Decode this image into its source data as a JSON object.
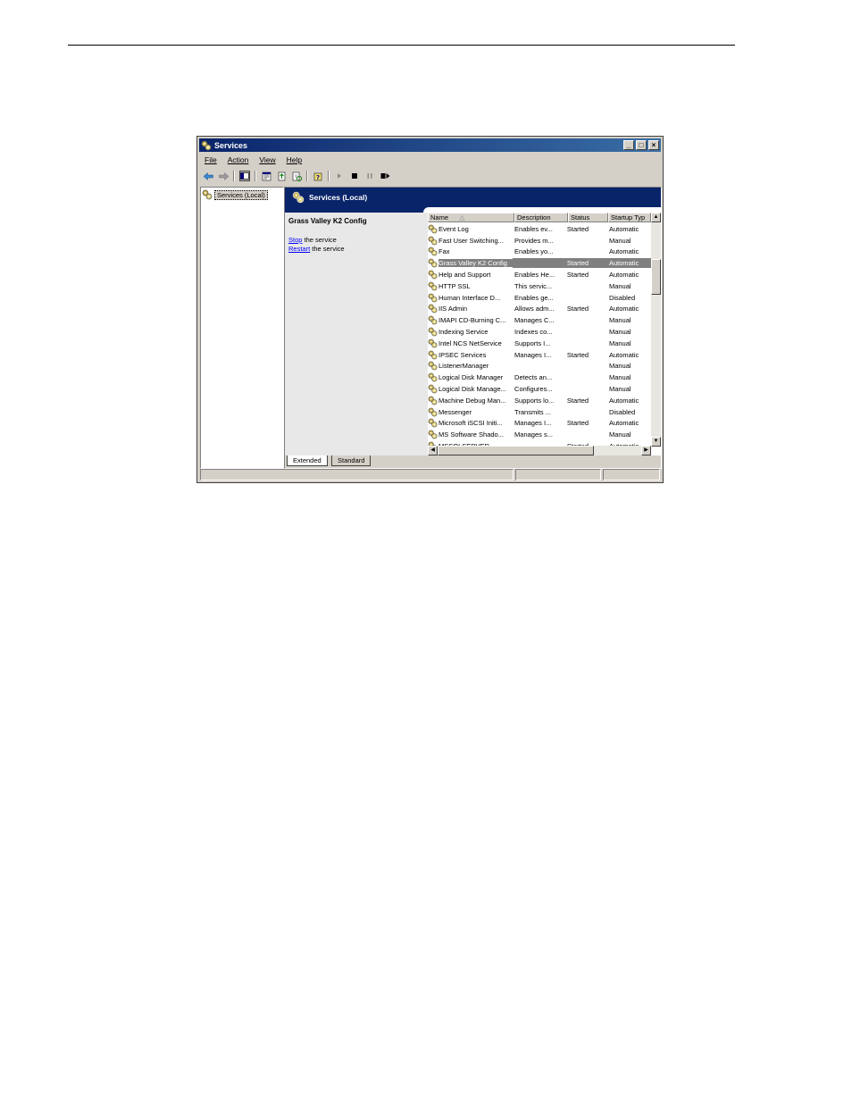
{
  "window": {
    "title": "Services",
    "controls": {
      "minimize": "_",
      "maximize": "□",
      "close": "×"
    }
  },
  "menu": [
    {
      "label": "File"
    },
    {
      "label": "Action"
    },
    {
      "label": "View"
    },
    {
      "label": "Help"
    }
  ],
  "toolbar": {
    "buttons": [
      "back-icon",
      "forward-icon",
      "show-hide-tree-icon",
      "properties-icon",
      "export-list-icon",
      "refresh-icon",
      "help-icon",
      "start-service-icon",
      "stop-service-icon",
      "pause-service-icon",
      "restart-service-icon"
    ]
  },
  "tree": {
    "root": "Services (Local)"
  },
  "right_panel": {
    "banner": "Services (Local)",
    "selected_service": "Grass Valley K2 Config",
    "actions": [
      {
        "link": "Stop",
        "rest": " the service"
      },
      {
        "link": "Restart",
        "rest": " the service"
      }
    ]
  },
  "list": {
    "columns": [
      "Name",
      "Description",
      "Status",
      "Startup Typ"
    ],
    "sort_indicator": "△",
    "rows": [
      {
        "name": "Event Log",
        "description": "Enables ev...",
        "status": "Started",
        "startup": "Automatic"
      },
      {
        "name": "Fast User Switching...",
        "description": "Provides m...",
        "status": "",
        "startup": "Manual"
      },
      {
        "name": "Fax",
        "description": "Enables yo...",
        "status": "",
        "startup": "Automatic"
      },
      {
        "name": "Grass Valley K2 Config",
        "description": "",
        "status": "Started",
        "startup": "Automatic",
        "selected": true
      },
      {
        "name": "Help and Support",
        "description": "Enables He...",
        "status": "Started",
        "startup": "Automatic"
      },
      {
        "name": "HTTP SSL",
        "description": "This servic...",
        "status": "",
        "startup": "Manual"
      },
      {
        "name": "Human Interface D...",
        "description": "Enables ge...",
        "status": "",
        "startup": "Disabled"
      },
      {
        "name": "IIS Admin",
        "description": "Allows adm...",
        "status": "Started",
        "startup": "Automatic"
      },
      {
        "name": "IMAPI CD-Burning C...",
        "description": "Manages C...",
        "status": "",
        "startup": "Manual"
      },
      {
        "name": "Indexing Service",
        "description": "Indexes co...",
        "status": "",
        "startup": "Manual"
      },
      {
        "name": "Intel NCS NetService",
        "description": "Supports I...",
        "status": "",
        "startup": "Manual"
      },
      {
        "name": "IPSEC Services",
        "description": "Manages I...",
        "status": "Started",
        "startup": "Automatic"
      },
      {
        "name": "ListenerManager",
        "description": "",
        "status": "",
        "startup": "Manual"
      },
      {
        "name": "Logical Disk Manager",
        "description": "Detects an...",
        "status": "",
        "startup": "Manual"
      },
      {
        "name": "Logical Disk Manage...",
        "description": "Configures...",
        "status": "",
        "startup": "Manual"
      },
      {
        "name": "Machine Debug Man...",
        "description": "Supports lo...",
        "status": "Started",
        "startup": "Automatic"
      },
      {
        "name": "Messenger",
        "description": "Transmits ...",
        "status": "",
        "startup": "Disabled"
      },
      {
        "name": "Microsoft iSCSI Initi...",
        "description": "Manages I...",
        "status": "Started",
        "startup": "Automatic"
      },
      {
        "name": "MS Software Shado...",
        "description": "Manages s...",
        "status": "",
        "startup": "Manual"
      },
      {
        "name": "MSSQLSERVER",
        "description": "",
        "status": "Started",
        "startup": "Automatic"
      }
    ]
  },
  "tabs": [
    {
      "label": "Extended",
      "active": true
    },
    {
      "label": "Standard",
      "active": false
    }
  ],
  "colors": {
    "titlebar": "#0a246a",
    "banner": "#0a246a",
    "selection": "#808080",
    "link": "#0000ff"
  }
}
